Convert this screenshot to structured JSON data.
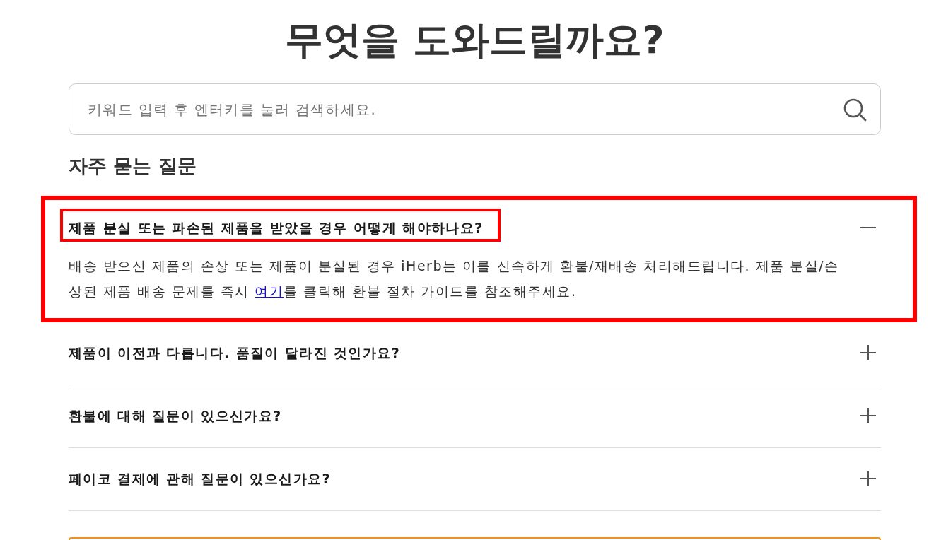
{
  "page": {
    "title": "무엇을 도와드릴까요?"
  },
  "search": {
    "placeholder": "키워드 입력 후 엔터키를 눌러 검색하세요."
  },
  "faq": {
    "heading": "자주 묻는 질문",
    "items": [
      {
        "question": "제품 분실 또는 파손된 제품을 받았을 경우 어떻게 해야하나요?",
        "expanded": true,
        "highlighted": true,
        "question_highlighted": true,
        "answer": [
          {
            "kind": "text",
            "text": "배송 받으신 제품의 손상 또는 제품이 분실된 경우 iHerb는 이를 신속하게 환불/재배송 처리해드립니다. 제품 분실/손상된 제품 배송 문제를 즉시 "
          },
          {
            "kind": "link",
            "text": "여기"
          },
          {
            "kind": "text",
            "text": "를 클릭해 환불 절차 가이드를 참조해주세요."
          }
        ]
      },
      {
        "question": "제품이 이전과 다릅니다. 품질이 달라진 것인가요?",
        "expanded": false,
        "highlighted": false,
        "question_highlighted": false
      },
      {
        "question": "환불에 대해 질문이 있으신가요?",
        "expanded": false,
        "highlighted": false,
        "question_highlighted": false
      },
      {
        "question": "페이코 결제에 관해 질문이 있으신가요?",
        "expanded": false,
        "highlighted": false,
        "question_highlighted": false
      }
    ]
  }
}
